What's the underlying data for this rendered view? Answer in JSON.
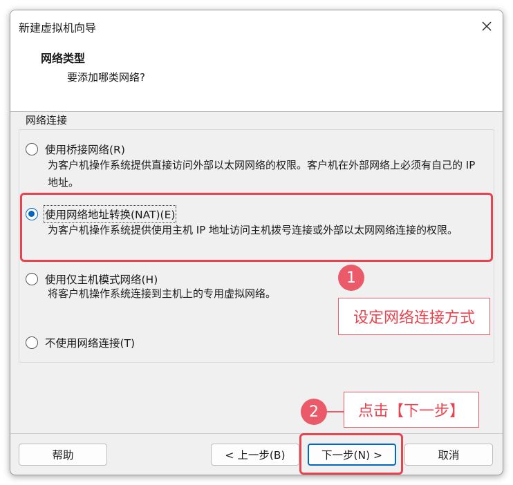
{
  "window": {
    "title": "新建虚拟机向导",
    "close_icon": "close-icon"
  },
  "header": {
    "title": "网络类型",
    "subtitle": "要添加哪类网络?"
  },
  "group": {
    "label": "网络连接"
  },
  "options": [
    {
      "label": "使用桥接网络(R)",
      "desc": "为客户机操作系统提供直接访问外部以太网网络的权限。客户机在外部网络上必须有自己的 IP 地址。",
      "checked": false
    },
    {
      "label": "使用网络地址转换(NAT)(E)",
      "desc": "为客户机操作系统提供使用主机 IP 地址访问主机拨号连接或外部以太网网络连接的权限。",
      "checked": true
    },
    {
      "label": "使用仅主机模式网络(H)",
      "desc": "将客户机操作系统连接到主机上的专用虚拟网络。",
      "checked": false
    },
    {
      "label": "不使用网络连接(T)",
      "desc": "",
      "checked": false
    }
  ],
  "annotations": {
    "step1_number": "1",
    "step1_text": "设定网络连接方式",
    "step2_number": "2",
    "step2_text": "点击【下一步】",
    "accent_color": "#e8434f"
  },
  "buttons": {
    "help": "帮助",
    "back": "< 上一步(B)",
    "next": "下一步(N) >",
    "cancel": "取消"
  }
}
